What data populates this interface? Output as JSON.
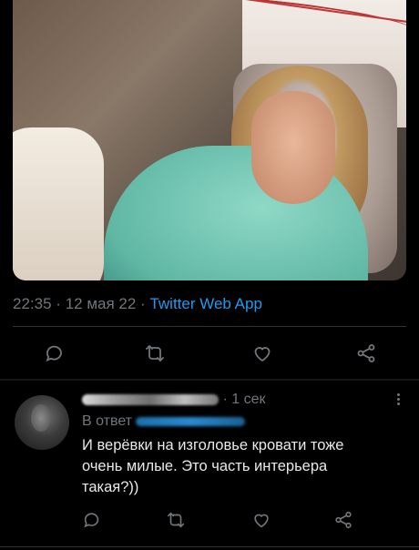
{
  "tweet": {
    "time": "22:35",
    "date": "12 мая 22",
    "app": "Twitter Web App",
    "separator": "·"
  },
  "actions": [
    "reply-icon",
    "retweet-icon",
    "like-icon",
    "share-icon"
  ],
  "reply": {
    "time": "· 1 сек",
    "reply_to_label": "В ответ",
    "text": "И верёвки на изголовье кровати тоже очень  милые. Это часть интерьера такая?))"
  },
  "colors": {
    "background": "#000000",
    "muted": "#71767b",
    "link": "#1d9bf0",
    "text": "#e7e9ea",
    "divider": "#2f3336"
  }
}
